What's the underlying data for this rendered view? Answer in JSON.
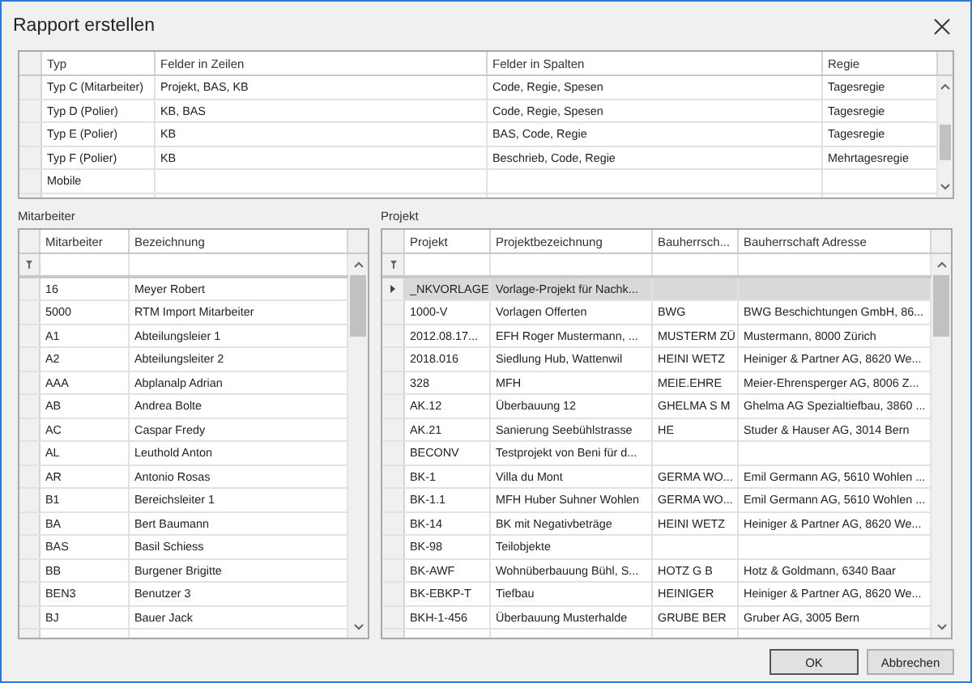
{
  "window": {
    "title": "Rapport erstellen"
  },
  "report_types": {
    "columns": [
      "Typ",
      "Felder in Zeilen",
      "Felder in Spalten",
      "Regie"
    ],
    "rows": [
      [
        "Typ C (Mitarbeiter)",
        "Projekt, BAS, KB",
        "Code, Regie, Spesen",
        "Tagesregie"
      ],
      [
        "Typ D (Polier)",
        "KB, BAS",
        "Code, Regie, Spesen",
        "Tagesregie"
      ],
      [
        "Typ E (Polier)",
        "KB",
        "BAS, Code, Regie",
        "Tagesregie"
      ],
      [
        "Typ F (Polier)",
        "KB",
        "Beschrieb, Code, Regie",
        "Mehrtagesregie"
      ],
      [
        "Mobile",
        "",
        "",
        ""
      ]
    ]
  },
  "employees": {
    "label": "Mitarbeiter",
    "columns": [
      "Mitarbeiter",
      "Bezeichnung"
    ],
    "rows": [
      [
        "16",
        "Meyer Robert"
      ],
      [
        "5000",
        "RTM Import Mitarbeiter"
      ],
      [
        "A1",
        "Abteilungsleier 1"
      ],
      [
        "A2",
        "Abteilungsleiter 2"
      ],
      [
        "AAA",
        "Abplanalp Adrian"
      ],
      [
        "AB",
        "Andrea Bolte"
      ],
      [
        "AC",
        "Caspar Fredy"
      ],
      [
        "AL",
        "Leuthold Anton"
      ],
      [
        "AR",
        "Antonio Rosas"
      ],
      [
        "B1",
        "Bereichsleiter 1"
      ],
      [
        "BA",
        "Bert Baumann"
      ],
      [
        "BAS",
        "Basil Schiess"
      ],
      [
        "BB",
        "Burgener Brigitte"
      ],
      [
        "BEN3",
        "Benutzer 3"
      ],
      [
        "BJ",
        "Bauer Jack"
      ]
    ]
  },
  "projects": {
    "label": "Projekt",
    "columns": [
      "Projekt",
      "Projektbezeichnung",
      "Bauherrsch...",
      "Bauherrschaft Adresse"
    ],
    "rows": [
      {
        "cells": [
          "_NKVORLAGE",
          "Vorlage-Projekt für Nachk...",
          "",
          ""
        ],
        "selected": true
      },
      {
        "cells": [
          "1000-V",
          "Vorlagen Offerten",
          "BWG",
          "BWG Beschichtungen GmbH, 86..."
        ],
        "selected": false
      },
      {
        "cells": [
          "2012.08.17...",
          "EFH Roger Mustermann, ...",
          "MUSTERM ZÜ",
          "Mustermann, 8000 Zürich"
        ],
        "selected": false
      },
      {
        "cells": [
          "2018.016",
          "Siedlung Hub, Wattenwil",
          "HEINI WETZ",
          "Heiniger & Partner AG, 8620 We..."
        ],
        "selected": false
      },
      {
        "cells": [
          "328",
          "MFH",
          "MEIE.EHRE",
          "Meier-Ehrensperger AG, 8006 Z..."
        ],
        "selected": false
      },
      {
        "cells": [
          "AK.12",
          "Überbauung 12",
          "GHELMA S M",
          "Ghelma AG Spezialtiefbau, 3860 ..."
        ],
        "selected": false
      },
      {
        "cells": [
          "AK.21",
          "Sanierung Seebühlstrasse",
          "HE",
          "Studer & Hauser AG, 3014 Bern"
        ],
        "selected": false
      },
      {
        "cells": [
          "BECONV",
          "Testprojekt von Beni für d...",
          "",
          ""
        ],
        "selected": false
      },
      {
        "cells": [
          "BK-1",
          "Villa du Mont",
          "GERMA WO...",
          "Emil Germann AG, 5610 Wohlen ..."
        ],
        "selected": false
      },
      {
        "cells": [
          "BK-1.1",
          "MFH Huber Suhner Wohlen",
          "GERMA WO...",
          "Emil Germann AG, 5610 Wohlen ..."
        ],
        "selected": false
      },
      {
        "cells": [
          "BK-14",
          "BK mit Negativbeträge",
          "HEINI WETZ",
          "Heiniger & Partner AG, 8620 We..."
        ],
        "selected": false
      },
      {
        "cells": [
          "BK-98",
          "Teilobjekte",
          "",
          ""
        ],
        "selected": false
      },
      {
        "cells": [
          "BK-AWF",
          "Wohnüberbauung Bühl, S...",
          "HOTZ G B",
          "Hotz & Goldmann, 6340 Baar"
        ],
        "selected": false
      },
      {
        "cells": [
          "BK-EBKP-T",
          "Tiefbau",
          "HEINIGER",
          "Heiniger & Partner AG, 8620 We..."
        ],
        "selected": false
      },
      {
        "cells": [
          "BKH-1-456",
          "Überbauung Musterhalde",
          "GRUBE BER",
          "Gruber AG, 3005 Bern"
        ],
        "selected": false
      }
    ]
  },
  "buttons": [
    "OK",
    "Abbrechen"
  ]
}
